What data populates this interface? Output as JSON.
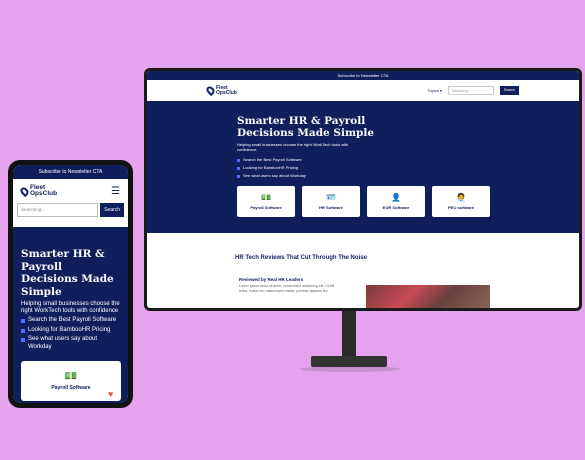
{
  "colors": {
    "navy": "#0f1f5c",
    "accent_bullet": "#4d6dff",
    "background": "#e4a3ec"
  },
  "desktop": {
    "topbar": "Subscribe to Newsletter CTA",
    "logo": {
      "line1": "Fleet",
      "line2": "OpsClub"
    },
    "nav": {
      "topics": "Topics ▾",
      "search_placeholder": "Searching...",
      "search_button": "Search"
    },
    "hero": {
      "title": "Smarter HR & Payroll Decisions Made Simple",
      "subtitle": "Helping small businesses choose the right WorkTech tools with confidence.",
      "bullets": [
        "Search the Best Payroll Software",
        "Looking for BambooHR Pricing",
        "See what users say about Workday"
      ],
      "cards": [
        {
          "label": "Payroll Software",
          "icon": "money-bill-icon"
        },
        {
          "label": "HR Software",
          "icon": "id-card-icon"
        },
        {
          "label": "EOR Software",
          "icon": "user-icon"
        },
        {
          "label": "PEO software",
          "icon": "user-tie-icon"
        }
      ]
    },
    "content": {
      "section_title": "HR Tech Reviews That Cut Through The Noise",
      "review_title": "Reviewed by Real HR Leaders",
      "review_text": "Lorem ipsum dolor sit amet, consectetur adipiscing elit. Ut elit tellus, luctus nec ullamcorper mattis, pulvinar dapibus leo."
    }
  },
  "mobile": {
    "topbar": "Subscribe to Newsletter CTA",
    "logo": {
      "line1": "Fleet",
      "line2": "OpsClub"
    },
    "search_placeholder": "Searching...",
    "search_button": "Search",
    "hero": {
      "title": "Smarter HR & Payroll Decisions Made Simple",
      "subtitle": "Helping small businesses choose the right WorkTech tools with confidence",
      "bullets": [
        "Search the Best Payroll Software",
        "Looking for BambooHR Pricing",
        "See what users say about Workday"
      ],
      "card_label": "Payroll Software"
    }
  }
}
